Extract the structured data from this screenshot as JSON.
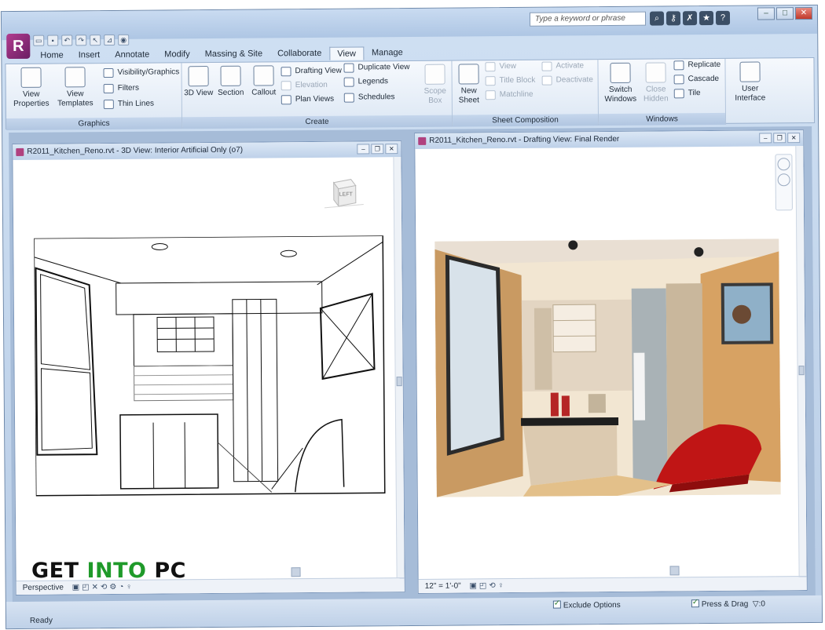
{
  "quick_access": {
    "search_placeholder": "Type a keyword or phrase"
  },
  "tabs": [
    "Home",
    "Insert",
    "Annotate",
    "Modify",
    "Massing & Site",
    "Collaborate",
    "View",
    "Manage"
  ],
  "active_tab": "View",
  "ribbon": {
    "graphics": {
      "title": "Graphics",
      "view_properties": "View Properties",
      "view_templates": "View Templates",
      "visibility_graphics": "Visibility/Graphics",
      "filters": "Filters",
      "thin_lines": "Thin Lines"
    },
    "create": {
      "title": "Create",
      "view_3d": "3D View",
      "section": "Section",
      "callout": "Callout",
      "drafting_view": "Drafting View",
      "elevation": "Elevation",
      "plan_views": "Plan Views",
      "duplicate_view": "Duplicate View",
      "legends": "Legends",
      "schedules": "Schedules",
      "scope_box": "Scope Box"
    },
    "sheet_composition": {
      "title": "Sheet Composition",
      "new_sheet": "New Sheet",
      "view": "View",
      "title_block": "Title Block",
      "matchline": "Matchline",
      "activate": "Activate",
      "deactivate": "Deactivate"
    },
    "windows": {
      "title": "Windows",
      "switch_windows": "Switch Windows",
      "close_hidden": "Close Hidden",
      "replicate": "Replicate",
      "cascade": "Cascade",
      "tile": "Tile"
    },
    "user_interface": "User Interface"
  },
  "views": {
    "left_title": "R2011_Kitchen_Reno.rvt - 3D View: Interior Artificial Only (o7)",
    "right_title": "R2011_Kitchen_Reno.rvt - Drafting View: Final Render",
    "viewcube_label": "LEFT",
    "left_bar": "Perspective",
    "right_bar": "12\" = 1'-0\""
  },
  "status": {
    "text": "Ready",
    "exclude_options": "Exclude Options",
    "press_drag": "Press & Drag",
    "filter_count": ":0"
  },
  "watermark": {
    "get": "GET",
    "into": "INTO",
    "pc": "PC"
  },
  "colors": {
    "accent": "#b0417f",
    "watermark_green": "#1f9a2a"
  }
}
